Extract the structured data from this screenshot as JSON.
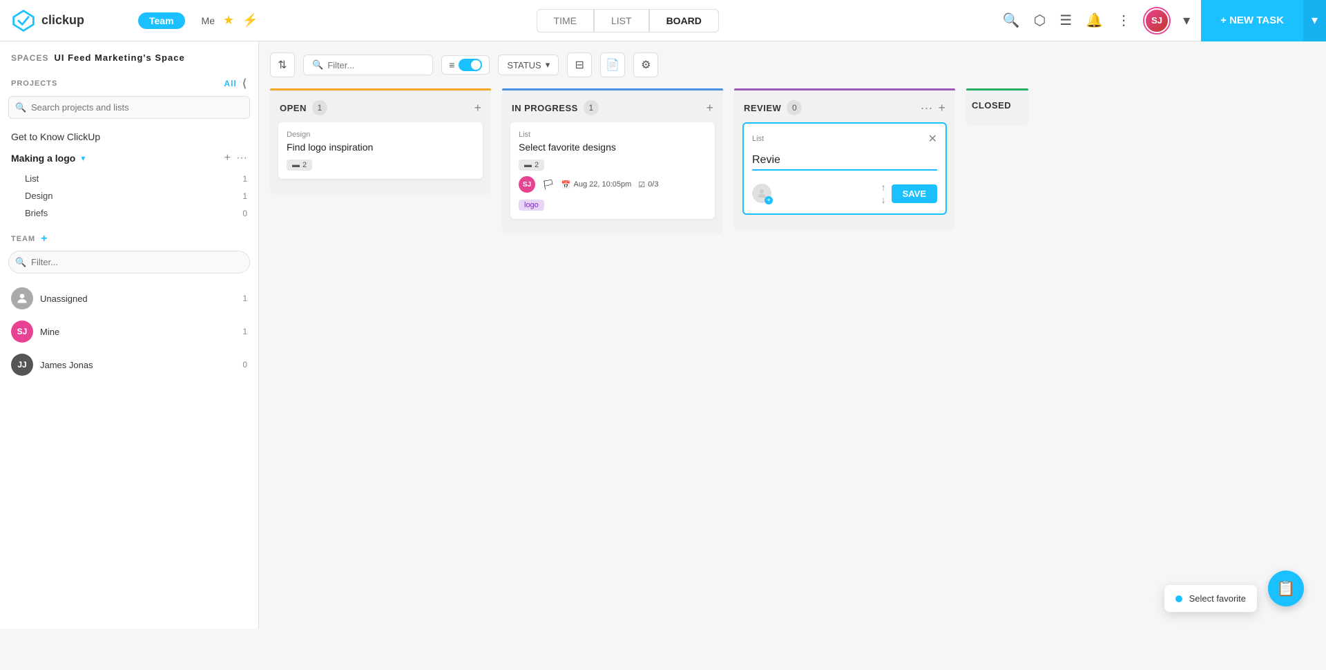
{
  "topnav": {
    "logo_text": "clickup",
    "team_label": "Team",
    "me_label": "Me",
    "tabs": [
      {
        "id": "time",
        "label": "TIME"
      },
      {
        "id": "list",
        "label": "LIST"
      },
      {
        "id": "board",
        "label": "BOARD",
        "active": true
      }
    ],
    "filter_placeholder": "Filter...",
    "new_task_label": "+ NEW TASK",
    "avatar_initials": "SJ"
  },
  "sidebar": {
    "spaces_label": "SPACES",
    "space_name": "UI Feed Marketing's Space",
    "projects_label": "PROJECTS",
    "all_label": "All",
    "search_placeholder": "Search projects and lists",
    "standalone_item": "Get to Know ClickUp",
    "project": {
      "name": "Making a logo",
      "sub_items": [
        {
          "label": "List",
          "count": 1
        },
        {
          "label": "Design",
          "count": 1
        },
        {
          "label": "Briefs",
          "count": 0
        }
      ]
    },
    "team_label": "TEAM",
    "filter_placeholder": "Filter...",
    "members": [
      {
        "label": "Unassigned",
        "initials": "U",
        "bg": "#aaa",
        "color": "#fff",
        "count": 1
      },
      {
        "label": "Mine",
        "initials": "SJ",
        "bg": "#e84393",
        "color": "#fff",
        "count": 1
      },
      {
        "label": "James Jonas",
        "initials": "JJ",
        "bg": "#555",
        "color": "#fff",
        "count": 0
      }
    ]
  },
  "board": {
    "filter_placeholder": "Filter...",
    "status_label": "STATUS",
    "columns": [
      {
        "id": "open",
        "title": "OPEN",
        "count": 1,
        "bar_color": "#f5a623",
        "tasks": [
          {
            "list_label": "Design",
            "title": "Find logo inspiration",
            "priority": "2"
          }
        ]
      },
      {
        "id": "in_progress",
        "title": "IN PROGRESS",
        "count": 1,
        "bar_color": "#4a90e2",
        "tasks": [
          {
            "list_label": "List",
            "title": "Select favorite designs",
            "priority": "2",
            "avatar": "SJ",
            "date": "Aug 22, 10:05pm",
            "checklist": "0/3",
            "tag": "logo"
          }
        ]
      },
      {
        "id": "review",
        "title": "REVIEW",
        "count": 0,
        "bar_color": "#9b59b6",
        "new_list_form": {
          "label": "List",
          "input_value": "Revie",
          "input_placeholder": "Revie",
          "save_label": "SAVE"
        }
      },
      {
        "id": "closed",
        "title": "CLOSED",
        "count": null,
        "bar_color": "#27ae60"
      }
    ]
  },
  "bottom_popup": {
    "text": "Select favorite"
  },
  "icons": {
    "search": "🔍",
    "box": "⬡",
    "bars": "☰",
    "bell": "🔔",
    "dots_v": "⋮",
    "chevron_down": "▾",
    "star": "★",
    "bolt": "⚡",
    "plus": "+",
    "ellipsis": "···",
    "close": "✕",
    "arrow_up": "↑",
    "arrow_down": "↓",
    "flag": "🏳",
    "calendar": "📅",
    "check": "☑",
    "filter": "⊟",
    "settings": "⚙",
    "sort": "⇅",
    "list_icon": "≡",
    "clipboard": "📋"
  }
}
